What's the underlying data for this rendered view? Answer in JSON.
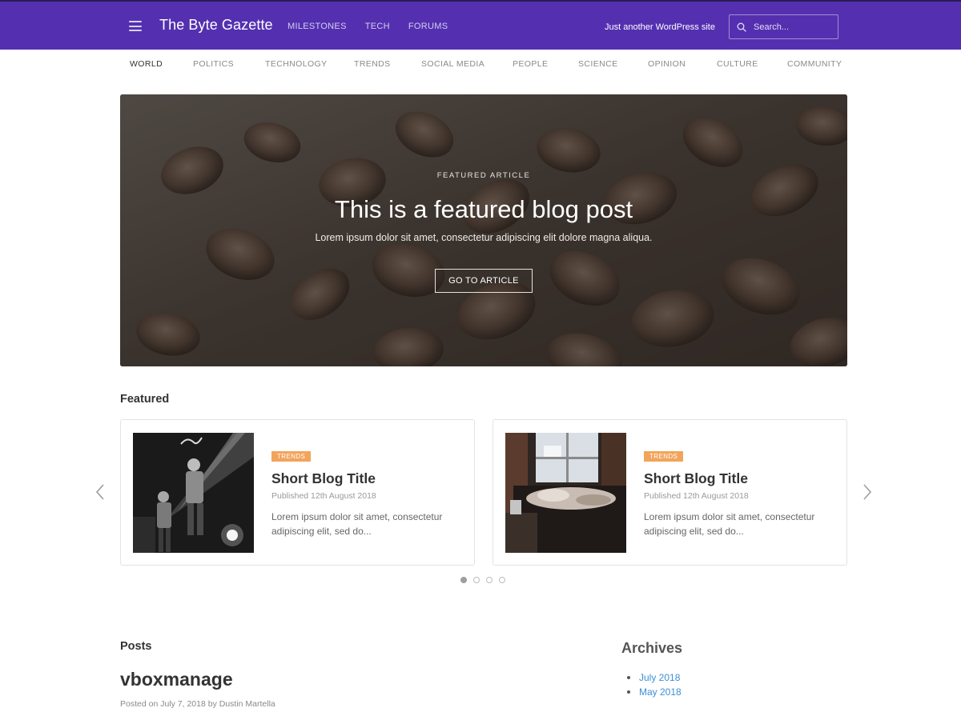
{
  "header": {
    "brand": "The Byte Gazette",
    "nav": [
      "MILESTONES",
      "TECH",
      "FORUMS"
    ],
    "tagline": "Just another WordPress site",
    "search_placeholder": "Search...",
    "bg_color": "#5430b0"
  },
  "categories": {
    "items": [
      "WORLD",
      "POLITICS",
      "TECHNOLOGY",
      "TRENDS",
      "SOCIAL MEDIA",
      "PEOPLE",
      "SCIENCE",
      "OPINION",
      "CULTURE",
      "COMMUNITY"
    ],
    "active": "WORLD"
  },
  "hero": {
    "kicker": "FEATURED ARTICLE",
    "title": "This is a featured blog post",
    "subtitle": "Lorem ipsum dolor sit amet, consectetur adipiscing elit dolore magna aliqua.",
    "button": "GO TO ARTICLE"
  },
  "featured": {
    "heading": "Featured",
    "cards": [
      {
        "badge": "TRENDS",
        "title": "Short Blog Title",
        "date": "Published 12th August 2018",
        "excerpt": "Lorem ipsum dolor sit amet, consectetur adipiscing elit, sed do..."
      },
      {
        "badge": "TRENDS",
        "title": "Short Blog Title",
        "date": "Published 12th August 2018",
        "excerpt": "Lorem ipsum dolor sit amet, consectetur adipiscing elit, sed do..."
      }
    ],
    "badge_color": "#f2a45b",
    "slide_count": 4,
    "active_slide": 1
  },
  "posts": {
    "heading": "Posts",
    "items": [
      {
        "title": "vboxmanage",
        "meta": "Posted on July 7, 2018 by Dustin Martella"
      }
    ]
  },
  "archives": {
    "heading": "Archives",
    "items": [
      "July 2018",
      "May 2018"
    ],
    "link_color": "#3b8fd6"
  },
  "icons": {
    "menu": "hamburger-menu-icon",
    "search": "search-icon",
    "prev": "chevron-left-icon",
    "next": "chevron-right-icon"
  }
}
